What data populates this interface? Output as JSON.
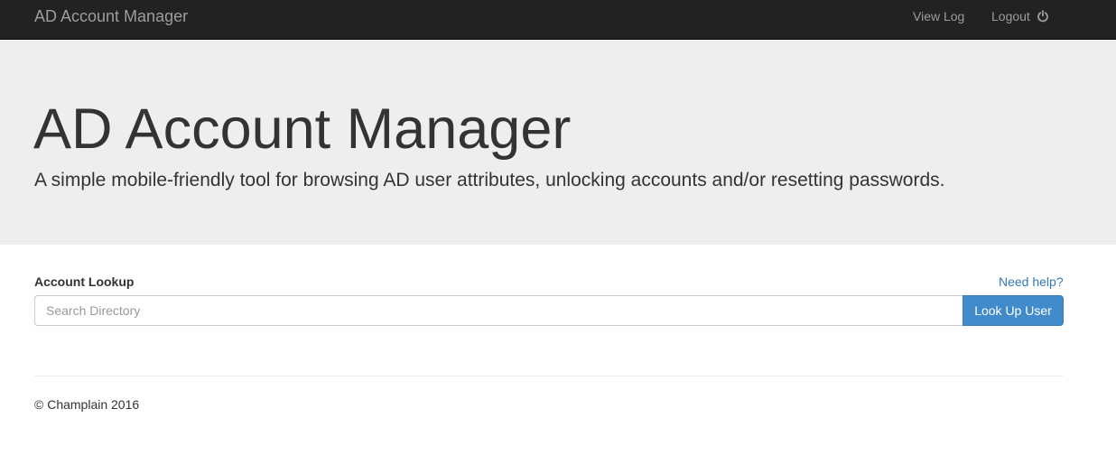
{
  "navbar": {
    "brand": "AD Account Manager",
    "links": {
      "view_log": "View Log",
      "logout": "Logout"
    },
    "logout_icon": "power-icon"
  },
  "hero": {
    "title": "AD Account Manager",
    "subtitle": "A simple mobile-friendly tool for browsing AD user attributes, unlocking accounts and/or resetting passwords."
  },
  "lookup": {
    "label": "Account Lookup",
    "help_link": "Need help?",
    "search_placeholder": "Search Directory",
    "search_value": "",
    "button_label": "Look Up User"
  },
  "footer": {
    "copyright": "© Champlain 2016"
  },
  "colors": {
    "navbar_bg": "#222222",
    "jumbotron_bg": "#eeeeee",
    "primary_button": "#428bca",
    "link": "#337ab7"
  }
}
